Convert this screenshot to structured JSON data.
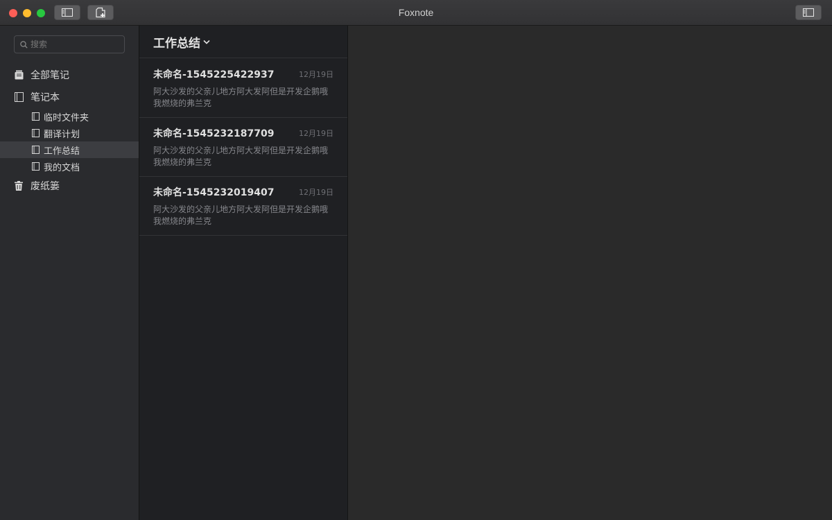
{
  "window": {
    "title": "Foxnote"
  },
  "search": {
    "placeholder": "搜索"
  },
  "sidebar": {
    "all_notes": "全部笔记",
    "notebooks": "笔记本",
    "folders": [
      {
        "label": "临时文件夹"
      },
      {
        "label": "翻译计划"
      },
      {
        "label": "工作总结",
        "active": true
      },
      {
        "label": "我的文档"
      }
    ],
    "trash": "废纸篓"
  },
  "note_list": {
    "title": "工作总结",
    "notes": [
      {
        "title": "未命名-1545225422937",
        "date": "12月19日",
        "preview": "阿大沙发的父亲儿地方阿大发阿但是开发企鹅哦我燃烧的弗兰克"
      },
      {
        "title": "未命名-1545232187709",
        "date": "12月19日",
        "preview": "阿大沙发的父亲儿地方阿大发阿但是开发企鹅哦我燃烧的弗兰克"
      },
      {
        "title": "未命名-1545232019407",
        "date": "12月19日",
        "preview": "阿大沙发的父亲儿地方阿大发阿但是开发企鹅哦我燃烧的弗兰克"
      }
    ]
  }
}
